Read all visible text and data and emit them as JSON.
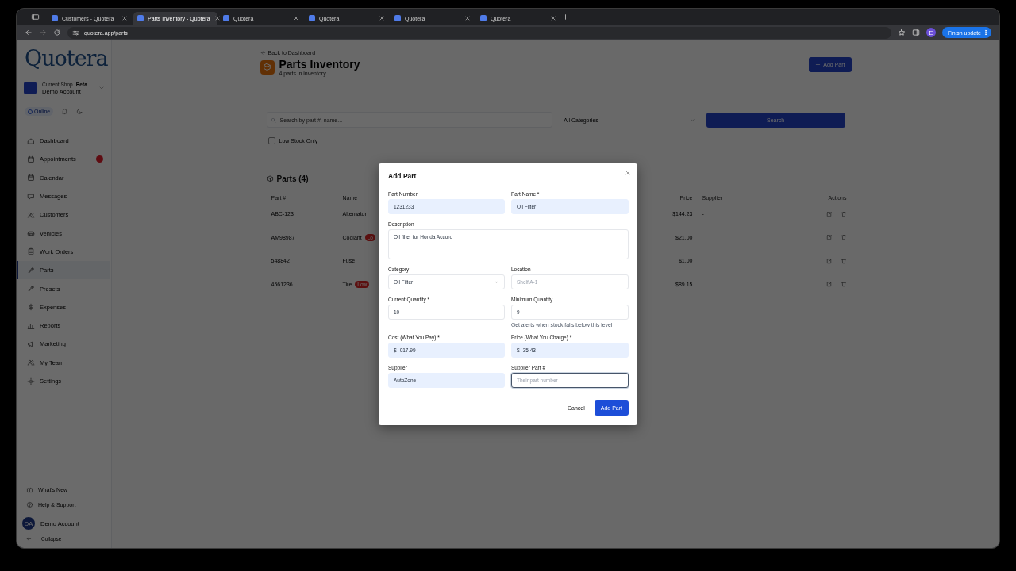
{
  "browser": {
    "tabs": [
      {
        "title": "Customers - Quotera",
        "selected": false
      },
      {
        "title": "Parts Inventory - Quotera",
        "selected": true
      },
      {
        "title": "Quotera",
        "selected": false
      },
      {
        "title": "Quotera",
        "selected": false
      },
      {
        "title": "Quotera",
        "selected": false
      },
      {
        "title": "Quotera",
        "selected": false
      }
    ],
    "address": "quotera.app/parts",
    "profile": "E",
    "update_button": "Finish update"
  },
  "sidebar": {
    "logo": "Quotera",
    "shop": {
      "label": "Current Shop",
      "badge": "Beta",
      "name": "Demo Account"
    },
    "status": "Online",
    "nav": [
      {
        "label": "Dashboard",
        "selected": false,
        "badge": false
      },
      {
        "label": "Appointments",
        "selected": false,
        "badge": true
      },
      {
        "label": "Calendar",
        "selected": false,
        "badge": false
      },
      {
        "label": "Messages",
        "selected": false,
        "badge": false
      },
      {
        "label": "Customers",
        "selected": false,
        "badge": false
      },
      {
        "label": "Vehicles",
        "selected": false,
        "badge": false
      },
      {
        "label": "Work Orders",
        "selected": false,
        "badge": false
      },
      {
        "label": "Parts",
        "selected": true,
        "badge": false
      },
      {
        "label": "Presets",
        "selected": false,
        "badge": false
      },
      {
        "label": "Expenses",
        "selected": false,
        "badge": false
      },
      {
        "label": "Reports",
        "selected": false,
        "badge": false
      },
      {
        "label": "Marketing",
        "selected": false,
        "badge": false
      },
      {
        "label": "My Team",
        "selected": false,
        "badge": false
      },
      {
        "label": "Settings",
        "selected": false,
        "badge": false
      }
    ],
    "footer": [
      "What's New",
      "Help & Support"
    ],
    "user": {
      "initials": "DA",
      "name": "Demo Account"
    },
    "collapse": "Collapse"
  },
  "page": {
    "back": "Back to Dashboard",
    "title": "Parts Inventory",
    "subtitle": "4 parts in inventory",
    "add_button": "Add Part",
    "search": {
      "placeholder": "Search by part #, name..."
    },
    "category": "All Categories",
    "search_button": "Search",
    "low_stock_only": {
      "label": "Low Stock Only",
      "checked": false
    },
    "section": "Parts (4)",
    "table": {
      "columns": [
        "Part #",
        "Name",
        "Price",
        "Supplier",
        "Actions"
      ],
      "rows": [
        {
          "part": "ABC-123",
          "name": "Alternator",
          "price": "$144.23",
          "supplier": "-"
        },
        {
          "part": "AM98987",
          "name": "Coolant",
          "badge": "Lo",
          "price": "$21.00"
        },
        {
          "part": "548842",
          "name": "Fuse",
          "price": "$1.00"
        },
        {
          "part": "4561236",
          "name": "Tire",
          "badge": "Low",
          "price": "$89.15"
        }
      ]
    }
  },
  "modal": {
    "title": "Add Part",
    "fields": [
      {
        "label": "Part Number",
        "kind": "text",
        "value": "1231233",
        "autofilled": true,
        "focused": false
      },
      {
        "label": "Part Name *",
        "kind": "text",
        "value": "Oil Filter",
        "autofilled": true,
        "focused": false
      },
      {
        "label": "Description",
        "kind": "textarea",
        "value": "Oil filter for Honda Accord",
        "autofilled": false,
        "focused": false
      },
      {
        "label": "Category",
        "kind": "select",
        "value": "Oil Filter",
        "autofilled": false,
        "focused": false
      },
      {
        "label": "Location",
        "kind": "text",
        "placeholder": "Shelf A-1",
        "autofilled": false,
        "focused": false
      },
      {
        "label": "Current Quantity *",
        "kind": "text",
        "value": "10",
        "autofilled": false,
        "focused": false
      },
      {
        "label": "Minimum Quantity",
        "kind": "text",
        "value": "9",
        "hint": "Get alerts when stock falls below this level",
        "autofilled": false,
        "focused": false
      },
      {
        "label": "Cost (What You Pay) *",
        "kind": "currency",
        "prefix": "$",
        "value": "017.99",
        "autofilled": true,
        "focused": false
      },
      {
        "label": "Price (What You Charge) *",
        "kind": "currency",
        "prefix": "$",
        "value": "35.43",
        "autofilled": true,
        "focused": false
      },
      {
        "label": "Supplier",
        "kind": "text",
        "value": "AutoZone",
        "autofilled": true,
        "focused": false
      },
      {
        "label": "Supplier Part #",
        "kind": "text",
        "placeholder": "Their part number",
        "autofilled": false,
        "focused": true
      }
    ],
    "cancel": "Cancel",
    "submit": "Add Part"
  }
}
